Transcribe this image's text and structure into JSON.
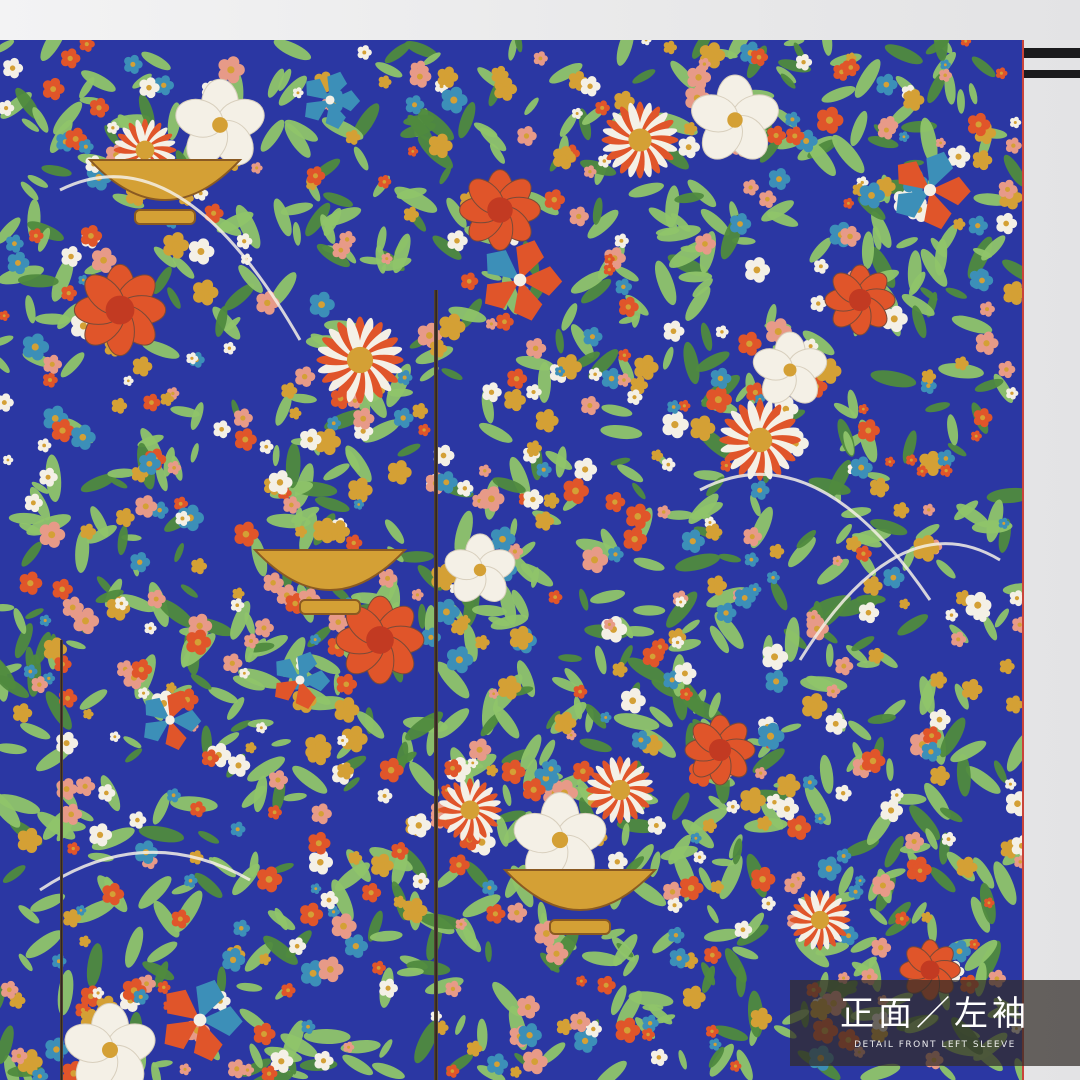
{
  "photo": {
    "subject": "kimono-pattern-photo",
    "palette": {
      "ground": "#2b37a3",
      "leaf": "#8fc46a",
      "leaf_dark": "#4f8a3e",
      "orange": "#e0552a",
      "white": "#f4f0e6",
      "teal": "#3c8fb8",
      "gold": "#d4a035",
      "pink": "#e79a88",
      "brown": "#7a4a38",
      "lining_red": "#c9443b"
    }
  },
  "caption": {
    "main": "正面／左袖",
    "sub": "DETAIL FRONT LEFT SLEEVE"
  }
}
